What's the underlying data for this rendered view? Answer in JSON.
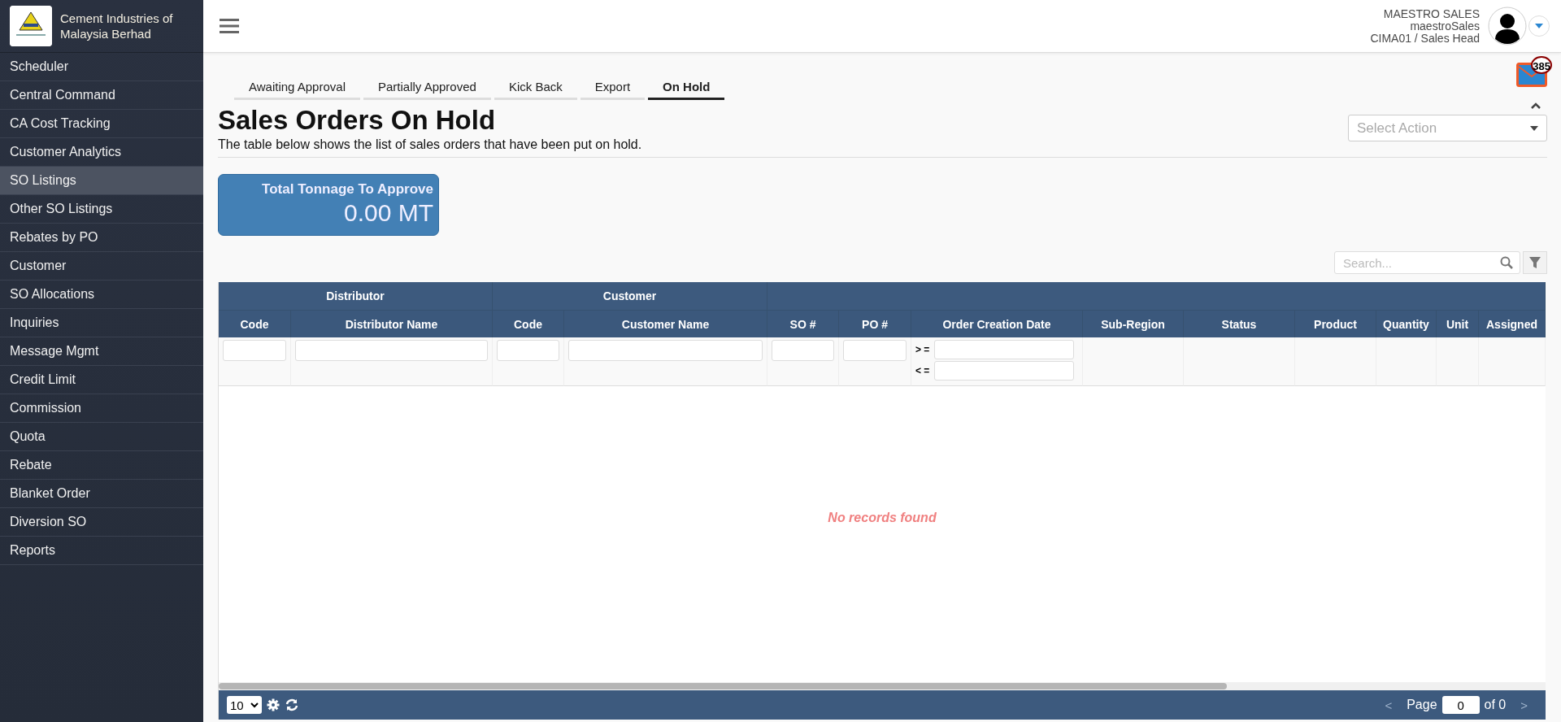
{
  "sidebar": {
    "company": "Cement Industries of Malaysia Berhad",
    "items": [
      {
        "label": "Scheduler",
        "selected": false
      },
      {
        "label": "Central Command",
        "selected": false
      },
      {
        "label": "CA Cost Tracking",
        "selected": false
      },
      {
        "label": "Customer Analytics",
        "selected": false
      },
      {
        "label": "SO Listings",
        "selected": true
      },
      {
        "label": "Other SO Listings",
        "selected": false
      },
      {
        "label": "Rebates by PO",
        "selected": false
      },
      {
        "label": "Customer",
        "selected": false
      },
      {
        "label": "SO Allocations",
        "selected": false
      },
      {
        "label": "Inquiries",
        "selected": false
      },
      {
        "label": "Message Mgmt",
        "selected": false
      },
      {
        "label": "Credit Limit",
        "selected": false
      },
      {
        "label": "Commission",
        "selected": false
      },
      {
        "label": "Quota",
        "selected": false
      },
      {
        "label": "Rebate",
        "selected": false
      },
      {
        "label": "Blanket Order",
        "selected": false
      },
      {
        "label": "Diversion SO",
        "selected": false
      },
      {
        "label": "Reports",
        "selected": false
      }
    ]
  },
  "user": {
    "name": "MAESTRO SALES",
    "login": "maestroSales",
    "role": "CIMA01 / Sales Head"
  },
  "messages": {
    "count": "385"
  },
  "tabs": [
    {
      "label": "Awaiting Approval",
      "selected": false
    },
    {
      "label": "Partially Approved",
      "selected": false
    },
    {
      "label": "Kick Back",
      "selected": false
    },
    {
      "label": "Export",
      "selected": false
    },
    {
      "label": "On Hold",
      "selected": true
    }
  ],
  "page": {
    "title": "Sales Orders On Hold",
    "subtitle": "The table below shows the list of sales orders that have been put on hold."
  },
  "action_select": {
    "placeholder": "Select Action"
  },
  "tonnage_card": {
    "label": "Total Tonnage To Approve",
    "value": "0.00 MT"
  },
  "search": {
    "placeholder": "Search..."
  },
  "table": {
    "groups": [
      {
        "label": "Distributor"
      },
      {
        "label": "Customer"
      }
    ],
    "columns": [
      {
        "label": "Code",
        "kind": "text"
      },
      {
        "label": "Distributor Name",
        "kind": "text"
      },
      {
        "label": "Code",
        "kind": "text"
      },
      {
        "label": "Customer Name",
        "kind": "text"
      },
      {
        "label": "SO #",
        "kind": "text"
      },
      {
        "label": "PO #",
        "kind": "text"
      },
      {
        "label": "Order Creation Date",
        "kind": "date_range",
        "from_label": "> =",
        "to_label": "< ="
      },
      {
        "label": "Sub-Region",
        "kind": "none"
      },
      {
        "label": "Status",
        "kind": "none"
      },
      {
        "label": "Product",
        "kind": "none"
      },
      {
        "label": "Quantity",
        "kind": "none"
      },
      {
        "label": "Unit",
        "kind": "none"
      },
      {
        "label": "Assigned",
        "kind": "none"
      }
    ],
    "empty_message": "No records found"
  },
  "pager": {
    "page_size": "10",
    "page_label": "Page",
    "page": "0",
    "of_label": "of 0",
    "prev": "<",
    "next": ">"
  }
}
